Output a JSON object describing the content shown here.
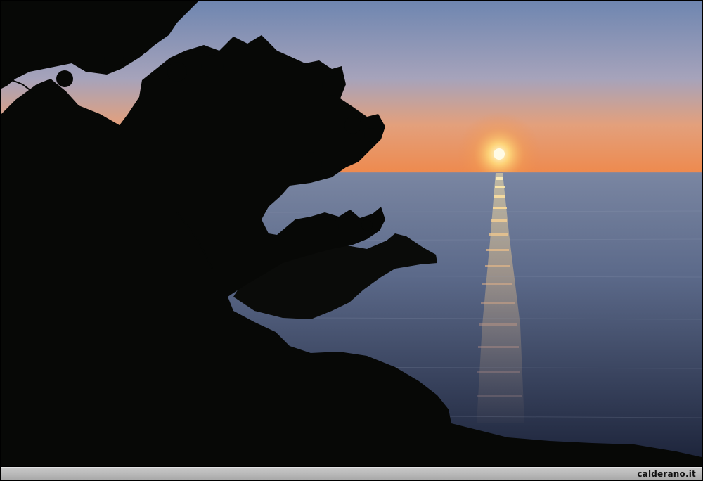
{
  "caption": {
    "site": "calderano.it"
  },
  "scene": {
    "palette": {
      "sky_top": "#6f86b0",
      "sky_mid": "#b3a5b6",
      "sky_horizon": "#ee8a4e",
      "sun": "#fff4c4",
      "sea_far": "#6c7893",
      "sea_near": "#1e2740",
      "silhouette": "#070806"
    }
  }
}
